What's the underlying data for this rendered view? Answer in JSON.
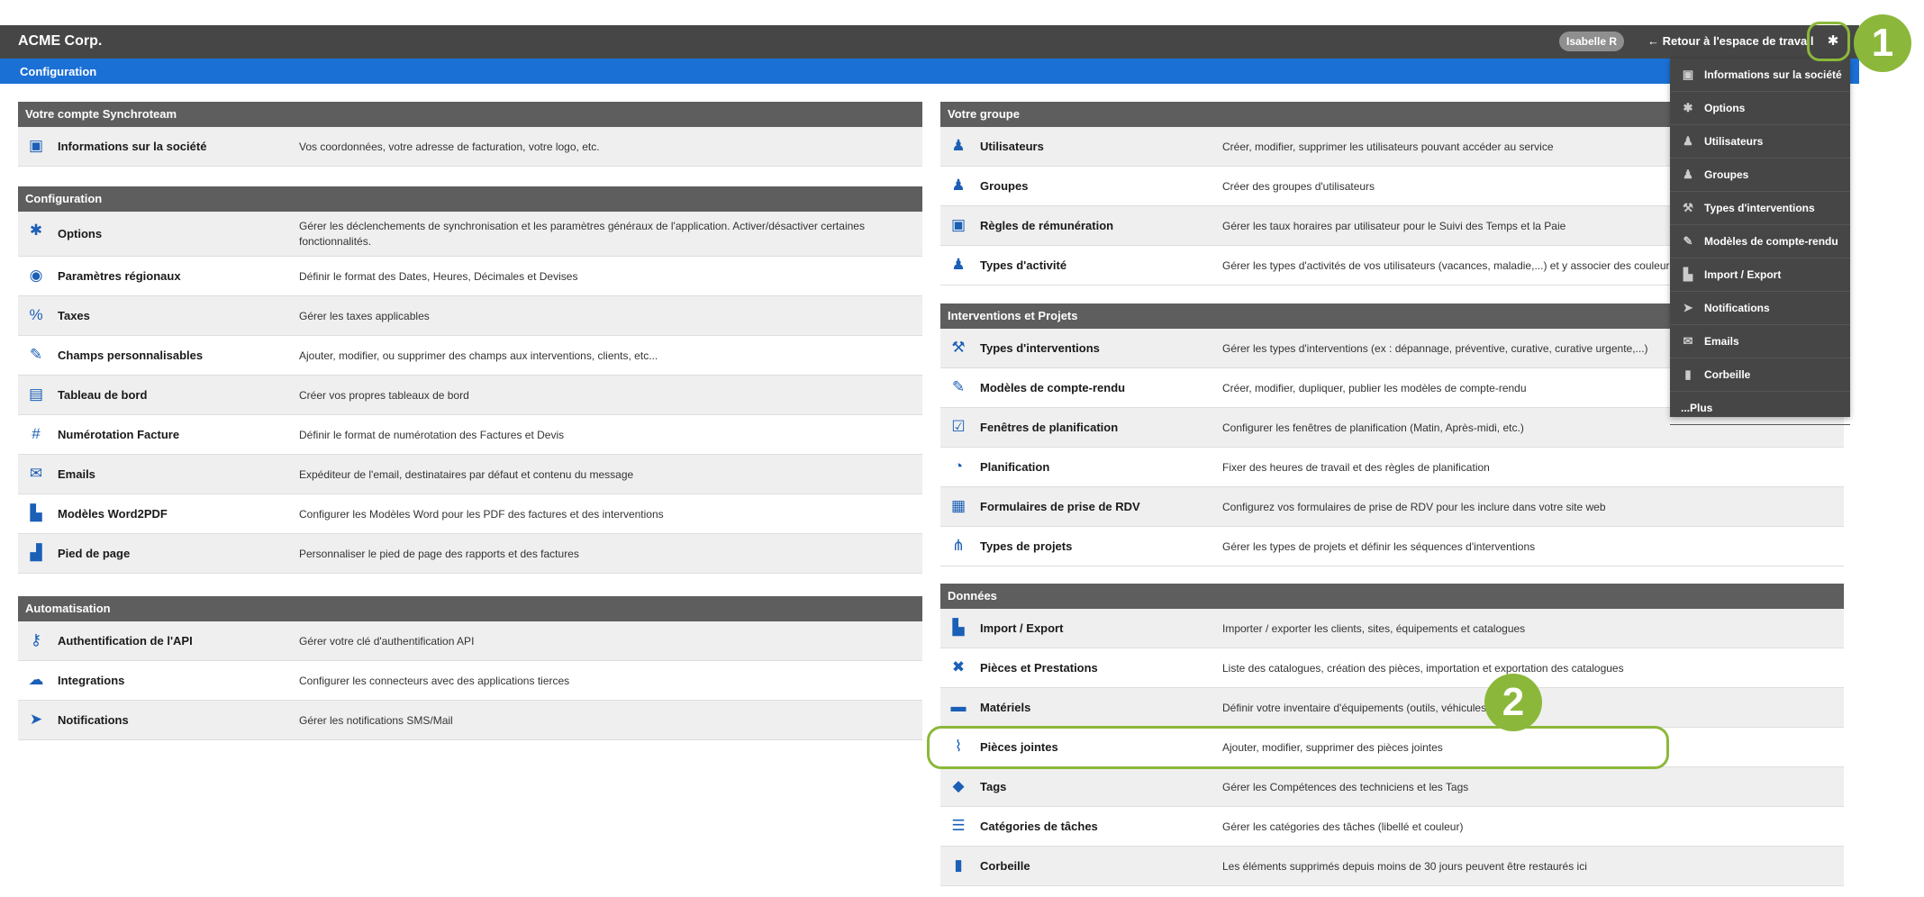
{
  "header": {
    "brand": "ACME Corp.",
    "user": "Isabelle R",
    "back_link": "← Retour à l'espace de travail",
    "section": "Configuration"
  },
  "left": {
    "panels": [
      {
        "title": "Votre compte Synchroteam",
        "items": [
          {
            "icon": "id-card-icon",
            "glyph": "▣",
            "label": "Informations sur la société",
            "desc": "Vos coordonnées, votre adresse de facturation, votre logo, etc."
          }
        ]
      },
      {
        "title": "Configuration",
        "items": [
          {
            "icon": "gear-icon",
            "glyph": "✱",
            "label": "Options",
            "desc": "Gérer les déclenchements de synchronisation et les paramètres généraux de l'application. Activer/désactiver certaines fonctionnalités."
          },
          {
            "icon": "globe-icon",
            "glyph": "◉",
            "label": "Paramètres régionaux",
            "desc": "Définir le format des Dates, Heures, Décimales et Devises"
          },
          {
            "icon": "percent-icon",
            "glyph": "%",
            "label": "Taxes",
            "desc": "Gérer les taxes applicables"
          },
          {
            "icon": "edit-icon",
            "glyph": "✎",
            "label": "Champs personnalisables",
            "desc": "Ajouter, modifier, ou supprimer des champs aux interventions, clients, etc..."
          },
          {
            "icon": "dashboard-icon",
            "glyph": "▤",
            "label": "Tableau de bord",
            "desc": "Créer vos propres tableaux de bord"
          },
          {
            "icon": "hash-icon",
            "glyph": "#",
            "label": "Numérotation Facture",
            "desc": "Définir le format de numérotation des Factures et Devis"
          },
          {
            "icon": "inbox-icon",
            "glyph": "✉",
            "label": "Emails",
            "desc": "Expéditeur de l'email, destinataires par défaut et contenu du message"
          },
          {
            "icon": "pdf-file-icon",
            "glyph": "▙",
            "label": "Modèles Word2PDF",
            "desc": "Configurer les Modèles Word pour les PDF des factures et des interventions"
          },
          {
            "icon": "footer-file-icon",
            "glyph": "▟",
            "label": "Pied de page",
            "desc": "Personnaliser le pied de page des rapports et des factures"
          }
        ]
      },
      {
        "title": "Automatisation",
        "items": [
          {
            "icon": "key-icon",
            "glyph": "⚷",
            "label": "Authentification de l'API",
            "desc": "Gérer votre clé d'authentification API"
          },
          {
            "icon": "cloud-icon",
            "glyph": "☁",
            "label": "Integrations",
            "desc": "Configurer les connecteurs avec des applications tierces"
          },
          {
            "icon": "paper-plane-icon",
            "glyph": "➤",
            "label": "Notifications",
            "desc": "Gérer les notifications SMS/Mail"
          }
        ]
      }
    ]
  },
  "right": {
    "panels": [
      {
        "title": "Votre groupe",
        "items": [
          {
            "icon": "user-edit-icon",
            "glyph": "♟",
            "label": "Utilisateurs",
            "desc": "Créer, modifier, supprimer les utilisateurs pouvant accéder au service"
          },
          {
            "icon": "users-icon",
            "glyph": "♟",
            "label": "Groupes",
            "desc": "Créer des groupes d'utilisateurs"
          },
          {
            "icon": "money-icon",
            "glyph": "▣",
            "label": "Règles de rémunération",
            "desc": "Gérer les taux horaires par utilisateur pour le Suivi des Temps et la Paie"
          },
          {
            "icon": "user-clock-icon",
            "glyph": "♟",
            "label": "Types d'activité",
            "desc": "Gérer les types d'activités de vos utilisateurs (vacances, maladie,...) et y associer des couleurs"
          }
        ]
      },
      {
        "title": "Interventions et Projets",
        "items": [
          {
            "icon": "wrench-icon",
            "glyph": "⚒",
            "label": "Types d'interventions",
            "desc": "Gérer les types d'interventions (ex : dépannage, préventive, curative, curative urgente,...)"
          },
          {
            "icon": "report-edit-icon",
            "glyph": "✎",
            "label": "Modèles de compte-rendu",
            "desc": "Créer, modifier, dupliquer, publier les modèles de compte-rendu"
          },
          {
            "icon": "calendar-check-icon",
            "glyph": "☑",
            "label": "Fenêtres de planification",
            "desc": "Configurer les fenêtres de planification (Matin, Après-midi, etc.)"
          },
          {
            "icon": "clock-icon",
            "glyph": "◔",
            "label": "Planification",
            "desc": "Fixer des heures de travail et des règles de planification"
          },
          {
            "icon": "clipboard-icon",
            "glyph": "▦",
            "label": "Formulaires de prise de RDV",
            "desc": "Configurez vos formulaires de prise de RDV pour les inclure dans votre site web"
          },
          {
            "icon": "project-diagram-icon",
            "glyph": "⋔",
            "label": "Types de projets",
            "desc": "Gérer les types de projets et définir les séquences d'interventions"
          }
        ]
      },
      {
        "title": "Données",
        "items": [
          {
            "icon": "csv-file-icon",
            "glyph": "▙",
            "label": "Import / Export",
            "desc": "Importer / exporter les clients, sites, équipements et catalogues"
          },
          {
            "icon": "tools-icon",
            "glyph": "✖",
            "label": "Pièces et Prestations",
            "desc": "Liste des catalogues, création des pièces, importation et exportation des catalogues"
          },
          {
            "icon": "toolbox-icon",
            "glyph": "▬",
            "label": "Matériels",
            "desc": "Définir votre inventaire d'équipements (outils, véhicules...)"
          },
          {
            "icon": "paperclip-icon",
            "glyph": "⌇",
            "label": "Pièces jointes",
            "desc": "Ajouter, modifier, supprimer des pièces jointes"
          },
          {
            "icon": "tags-icon",
            "glyph": "◆",
            "label": "Tags",
            "desc": "Gérer les Compétences des techniciens et les Tags"
          },
          {
            "icon": "list-icon",
            "glyph": "☰",
            "label": "Catégories de tâches",
            "desc": "Gérer les catégories des tâches (libellé et couleur)"
          },
          {
            "icon": "trash-icon",
            "glyph": "▮",
            "label": "Corbeille",
            "desc": "Les éléments supprimés depuis moins de 30 jours peuvent être restaurés ici"
          }
        ]
      }
    ]
  },
  "dropdown": {
    "items": [
      {
        "icon": "id-card-icon",
        "glyph": "▣",
        "label": "Informations sur la société"
      },
      {
        "icon": "gear-icon",
        "glyph": "✱",
        "label": "Options"
      },
      {
        "icon": "user-edit-icon",
        "glyph": "♟",
        "label": "Utilisateurs"
      },
      {
        "icon": "users-icon",
        "glyph": "♟",
        "label": "Groupes"
      },
      {
        "icon": "wrench-icon",
        "glyph": "⚒",
        "label": "Types d'interventions"
      },
      {
        "icon": "report-edit-icon",
        "glyph": "✎",
        "label": "Modèles de compte-rendu"
      },
      {
        "icon": "csv-file-icon",
        "glyph": "▙",
        "label": "Import / Export"
      },
      {
        "icon": "paper-plane-icon",
        "glyph": "➤",
        "label": "Notifications"
      },
      {
        "icon": "inbox-icon",
        "glyph": "✉",
        "label": "Emails"
      },
      {
        "icon": "trash-icon",
        "glyph": "▮",
        "label": "Corbeille"
      },
      {
        "icon": "",
        "glyph": "",
        "label": "...Plus"
      }
    ]
  },
  "callouts": [
    "1",
    "2"
  ],
  "colors": {
    "topbar": "#464646",
    "accent": "#1b70d6",
    "callout": "#8bb83a",
    "panel_header": "#5e5e5e"
  }
}
